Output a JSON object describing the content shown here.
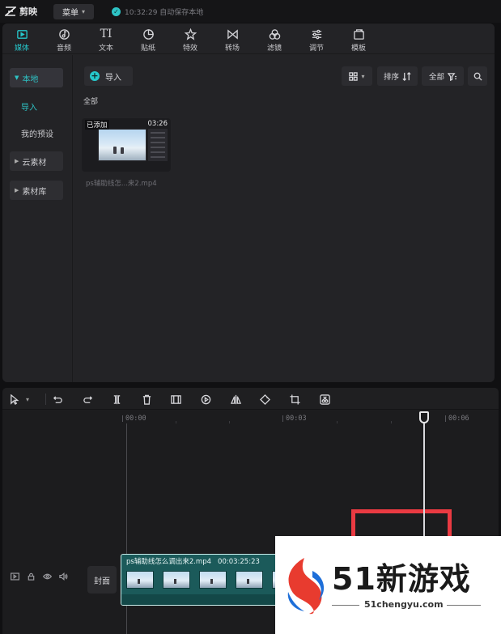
{
  "app": {
    "name": "剪映",
    "menu_label": "菜单",
    "save_status": "10:32:29 自动保存本地"
  },
  "tabs": [
    {
      "label": "媒体",
      "icon": "media-icon",
      "active": true
    },
    {
      "label": "音频",
      "icon": "audio-icon"
    },
    {
      "label": "文本",
      "icon": "text-icon",
      "glyph": "TI"
    },
    {
      "label": "贴纸",
      "icon": "sticker-icon"
    },
    {
      "label": "特效",
      "icon": "effects-icon"
    },
    {
      "label": "转场",
      "icon": "transition-icon"
    },
    {
      "label": "滤镜",
      "icon": "filter-icon"
    },
    {
      "label": "调节",
      "icon": "adjust-icon"
    },
    {
      "label": "模板",
      "icon": "template-icon"
    }
  ],
  "sidebar": {
    "local": "本地",
    "import": "导入",
    "presets": "我的预设",
    "cloud": "云素材",
    "library": "素材库"
  },
  "media_toolbar": {
    "import_label": "导入",
    "sort_label": "排序",
    "filter_all_label": "全部",
    "section_label": "全部"
  },
  "media_item": {
    "added_badge": "已添加",
    "duration": "03:26",
    "file_name": "ps辅助线怎...来2.mp4"
  },
  "timeline": {
    "ruler": [
      "00:00",
      "00:03",
      "00:06"
    ],
    "cover_label": "封面",
    "clip_name": "ps辅助线怎么调出来2.mp4",
    "clip_duration": "00:03:25:23"
  },
  "watermark": {
    "brand": "51新游戏",
    "url": "51chengyu.com"
  },
  "colors": {
    "accent": "#26c8cc",
    "highlight_box": "#ea3a42",
    "clip_fill": "#1b5a5a"
  }
}
